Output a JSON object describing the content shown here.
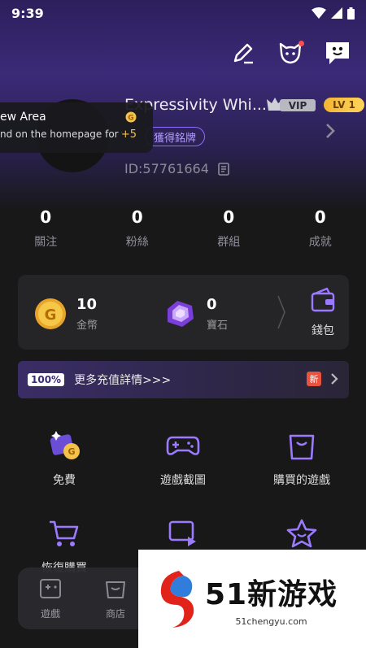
{
  "status_bar": {
    "time": "9:39"
  },
  "profile": {
    "username": "Expressivity Whi...",
    "vip_label": "VIP",
    "level_label": "LV 1",
    "badge_button": "獲得銘牌",
    "id_text": "ID:57761664"
  },
  "toast": {
    "title": "ew  Area",
    "message": "nd on the homepage for t...",
    "reward": "+5",
    "coin_letter": "G"
  },
  "stats": [
    {
      "value": "0",
      "label": "關注"
    },
    {
      "value": "0",
      "label": "粉絲"
    },
    {
      "value": "0",
      "label": "群組"
    },
    {
      "value": "0",
      "label": "成就"
    }
  ],
  "wallet": {
    "coins": {
      "value": "10",
      "label": "金幣"
    },
    "gems": {
      "value": "0",
      "label": "寶石"
    },
    "wallet_label": "錢包"
  },
  "recharge": {
    "percent": "100%",
    "text": "更多充值詳情>>>",
    "new_tag": "新"
  },
  "grid": [
    {
      "label": "免費",
      "icon": "free-coins-icon"
    },
    {
      "label": "遊戲截圖",
      "icon": "gamepad-icon"
    },
    {
      "label": "購買的遊戲",
      "icon": "shopping-bag-icon"
    },
    {
      "label": "恢復購買",
      "icon": "cart-icon"
    },
    {
      "label": "",
      "icon": "share-screen-icon"
    },
    {
      "label": "",
      "icon": "star-icon"
    }
  ],
  "bottom_nav": [
    {
      "label": "遊戲",
      "icon": "game-icon"
    },
    {
      "label": "商店",
      "icon": "store-icon"
    }
  ],
  "watermark": {
    "title": "51新游戏",
    "url": "51chengyu.com"
  },
  "colors": {
    "accent": "#8e6cff",
    "gold": "#f4c24a",
    "background": "#181818"
  }
}
